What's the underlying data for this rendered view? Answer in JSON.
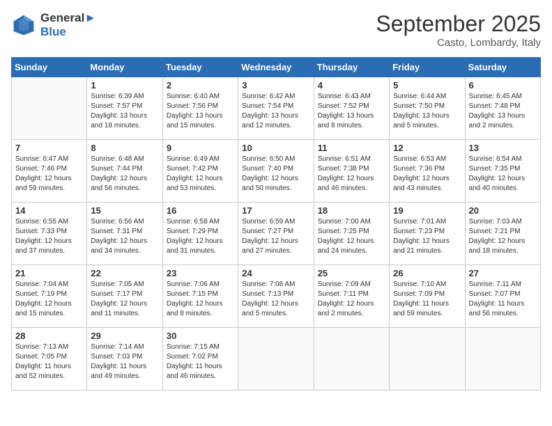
{
  "header": {
    "logo_line1": "General",
    "logo_line2": "Blue",
    "month": "September 2025",
    "location": "Casto, Lombardy, Italy"
  },
  "weekdays": [
    "Sunday",
    "Monday",
    "Tuesday",
    "Wednesday",
    "Thursday",
    "Friday",
    "Saturday"
  ],
  "weeks": [
    [
      {
        "day": "",
        "sunrise": "",
        "sunset": "",
        "daylight": ""
      },
      {
        "day": "1",
        "sunrise": "Sunrise: 6:39 AM",
        "sunset": "Sunset: 7:57 PM",
        "daylight": "Daylight: 13 hours and 18 minutes."
      },
      {
        "day": "2",
        "sunrise": "Sunrise: 6:40 AM",
        "sunset": "Sunset: 7:56 PM",
        "daylight": "Daylight: 13 hours and 15 minutes."
      },
      {
        "day": "3",
        "sunrise": "Sunrise: 6:42 AM",
        "sunset": "Sunset: 7:54 PM",
        "daylight": "Daylight: 13 hours and 12 minutes."
      },
      {
        "day": "4",
        "sunrise": "Sunrise: 6:43 AM",
        "sunset": "Sunset: 7:52 PM",
        "daylight": "Daylight: 13 hours and 8 minutes."
      },
      {
        "day": "5",
        "sunrise": "Sunrise: 6:44 AM",
        "sunset": "Sunset: 7:50 PM",
        "daylight": "Daylight: 13 hours and 5 minutes."
      },
      {
        "day": "6",
        "sunrise": "Sunrise: 6:45 AM",
        "sunset": "Sunset: 7:48 PM",
        "daylight": "Daylight: 13 hours and 2 minutes."
      }
    ],
    [
      {
        "day": "7",
        "sunrise": "Sunrise: 6:47 AM",
        "sunset": "Sunset: 7:46 PM",
        "daylight": "Daylight: 12 hours and 59 minutes."
      },
      {
        "day": "8",
        "sunrise": "Sunrise: 6:48 AM",
        "sunset": "Sunset: 7:44 PM",
        "daylight": "Daylight: 12 hours and 56 minutes."
      },
      {
        "day": "9",
        "sunrise": "Sunrise: 6:49 AM",
        "sunset": "Sunset: 7:42 PM",
        "daylight": "Daylight: 12 hours and 53 minutes."
      },
      {
        "day": "10",
        "sunrise": "Sunrise: 6:50 AM",
        "sunset": "Sunset: 7:40 PM",
        "daylight": "Daylight: 12 hours and 50 minutes."
      },
      {
        "day": "11",
        "sunrise": "Sunrise: 6:51 AM",
        "sunset": "Sunset: 7:38 PM",
        "daylight": "Daylight: 12 hours and 46 minutes."
      },
      {
        "day": "12",
        "sunrise": "Sunrise: 6:53 AM",
        "sunset": "Sunset: 7:36 PM",
        "daylight": "Daylight: 12 hours and 43 minutes."
      },
      {
        "day": "13",
        "sunrise": "Sunrise: 6:54 AM",
        "sunset": "Sunset: 7:35 PM",
        "daylight": "Daylight: 12 hours and 40 minutes."
      }
    ],
    [
      {
        "day": "14",
        "sunrise": "Sunrise: 6:55 AM",
        "sunset": "Sunset: 7:33 PM",
        "daylight": "Daylight: 12 hours and 37 minutes."
      },
      {
        "day": "15",
        "sunrise": "Sunrise: 6:56 AM",
        "sunset": "Sunset: 7:31 PM",
        "daylight": "Daylight: 12 hours and 34 minutes."
      },
      {
        "day": "16",
        "sunrise": "Sunrise: 6:58 AM",
        "sunset": "Sunset: 7:29 PM",
        "daylight": "Daylight: 12 hours and 31 minutes."
      },
      {
        "day": "17",
        "sunrise": "Sunrise: 6:59 AM",
        "sunset": "Sunset: 7:27 PM",
        "daylight": "Daylight: 12 hours and 27 minutes."
      },
      {
        "day": "18",
        "sunrise": "Sunrise: 7:00 AM",
        "sunset": "Sunset: 7:25 PM",
        "daylight": "Daylight: 12 hours and 24 minutes."
      },
      {
        "day": "19",
        "sunrise": "Sunrise: 7:01 AM",
        "sunset": "Sunset: 7:23 PM",
        "daylight": "Daylight: 12 hours and 21 minutes."
      },
      {
        "day": "20",
        "sunrise": "Sunrise: 7:03 AM",
        "sunset": "Sunset: 7:21 PM",
        "daylight": "Daylight: 12 hours and 18 minutes."
      }
    ],
    [
      {
        "day": "21",
        "sunrise": "Sunrise: 7:04 AM",
        "sunset": "Sunset: 7:19 PM",
        "daylight": "Daylight: 12 hours and 15 minutes."
      },
      {
        "day": "22",
        "sunrise": "Sunrise: 7:05 AM",
        "sunset": "Sunset: 7:17 PM",
        "daylight": "Daylight: 12 hours and 11 minutes."
      },
      {
        "day": "23",
        "sunrise": "Sunrise: 7:06 AM",
        "sunset": "Sunset: 7:15 PM",
        "daylight": "Daylight: 12 hours and 8 minutes."
      },
      {
        "day": "24",
        "sunrise": "Sunrise: 7:08 AM",
        "sunset": "Sunset: 7:13 PM",
        "daylight": "Daylight: 12 hours and 5 minutes."
      },
      {
        "day": "25",
        "sunrise": "Sunrise: 7:09 AM",
        "sunset": "Sunset: 7:11 PM",
        "daylight": "Daylight: 12 hours and 2 minutes."
      },
      {
        "day": "26",
        "sunrise": "Sunrise: 7:10 AM",
        "sunset": "Sunset: 7:09 PM",
        "daylight": "Daylight: 11 hours and 59 minutes."
      },
      {
        "day": "27",
        "sunrise": "Sunrise: 7:11 AM",
        "sunset": "Sunset: 7:07 PM",
        "daylight": "Daylight: 11 hours and 56 minutes."
      }
    ],
    [
      {
        "day": "28",
        "sunrise": "Sunrise: 7:13 AM",
        "sunset": "Sunset: 7:05 PM",
        "daylight": "Daylight: 11 hours and 52 minutes."
      },
      {
        "day": "29",
        "sunrise": "Sunrise: 7:14 AM",
        "sunset": "Sunset: 7:03 PM",
        "daylight": "Daylight: 11 hours and 49 minutes."
      },
      {
        "day": "30",
        "sunrise": "Sunrise: 7:15 AM",
        "sunset": "Sunset: 7:02 PM",
        "daylight": "Daylight: 11 hours and 46 minutes."
      },
      {
        "day": "",
        "sunrise": "",
        "sunset": "",
        "daylight": ""
      },
      {
        "day": "",
        "sunrise": "",
        "sunset": "",
        "daylight": ""
      },
      {
        "day": "",
        "sunrise": "",
        "sunset": "",
        "daylight": ""
      },
      {
        "day": "",
        "sunrise": "",
        "sunset": "",
        "daylight": ""
      }
    ]
  ]
}
